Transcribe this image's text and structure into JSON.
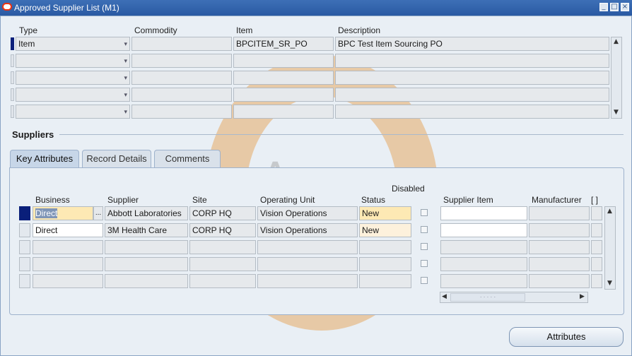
{
  "window": {
    "title": "Approved Supplier List (M1)",
    "minimize_glyph": "_",
    "maximize_glyph": "□",
    "close_glyph": "×"
  },
  "header_block": {
    "columns": {
      "type": "Type",
      "commodity": "Commodity",
      "item": "Item",
      "description": "Description"
    },
    "rows": [
      {
        "type": "Item",
        "commodity": "",
        "item": "BPCITEM_SR_PO",
        "description": "BPC Test Item Sourcing PO"
      },
      {
        "type": "",
        "commodity": "",
        "item": "",
        "description": ""
      },
      {
        "type": "",
        "commodity": "",
        "item": "",
        "description": ""
      },
      {
        "type": "",
        "commodity": "",
        "item": "",
        "description": ""
      },
      {
        "type": "",
        "commodity": "",
        "item": "",
        "description": ""
      }
    ]
  },
  "suppliers": {
    "section_title": "Suppliers",
    "tabs": [
      "Key Attributes",
      "Record Details",
      "Comments"
    ],
    "active_tab": "Key Attributes",
    "columns": {
      "business": "Business",
      "supplier": "Supplier",
      "site": "Site",
      "operating_unit": "Operating Unit",
      "status": "Status",
      "disabled": "Disabled",
      "supplier_item": "Supplier Item",
      "manufacturer": "Manufacturer",
      "folder": "[ ]"
    },
    "rows": [
      {
        "business": "Direct",
        "supplier": "Abbott Laboratories",
        "site": "CORP HQ",
        "operating_unit": "Vision Operations",
        "status": "New",
        "supplier_item": "",
        "manufacturer": ""
      },
      {
        "business": "Direct",
        "supplier": "3M Health Care",
        "site": "CORP HQ",
        "operating_unit": "Vision Operations",
        "status": "New",
        "supplier_item": "",
        "manufacturer": ""
      },
      {
        "business": "",
        "supplier": "",
        "site": "",
        "operating_unit": "",
        "status": "",
        "supplier_item": "",
        "manufacturer": ""
      },
      {
        "business": "",
        "supplier": "",
        "site": "",
        "operating_unit": "",
        "status": "",
        "supplier_item": "",
        "manufacturer": ""
      },
      {
        "business": "",
        "supplier": "",
        "site": "",
        "operating_unit": "",
        "status": "",
        "supplier_item": "",
        "manufacturer": ""
      }
    ],
    "lov_glyph": "..."
  },
  "buttons": {
    "attributes": "Attributes"
  },
  "watermark": {
    "text": "Apps"
  },
  "colors": {
    "title_bar": "#2a5aa3",
    "current_field": "#fde9b4",
    "watermark": "#e6aa64"
  }
}
